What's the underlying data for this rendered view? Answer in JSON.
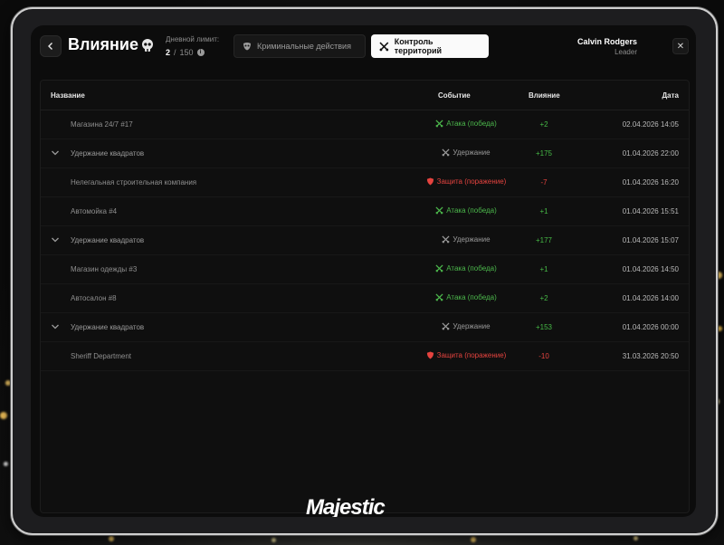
{
  "header": {
    "title": "Влияние",
    "limit_label": "Дневной лимит:",
    "limit_current": "2",
    "limit_separator": "/",
    "limit_max": "150",
    "tabs": [
      {
        "label": "Криминальные действия",
        "icon": "mask-icon",
        "active": false
      },
      {
        "label": "Контроль территорий",
        "icon": "crossed-swords-icon",
        "active": true
      }
    ],
    "user_name": "Calvin Rodgers",
    "user_role": "Leader"
  },
  "table": {
    "columns": {
      "name": "Название",
      "event": "Событие",
      "influence": "Влияние",
      "date": "Дата"
    },
    "rows": [
      {
        "name": "Магазина 24/7 #17",
        "group": false,
        "event": "Атака (победа)",
        "event_type": "attack",
        "influence": "+2",
        "date": "02.04.2026 14:05"
      },
      {
        "name": "Удержание квадратов",
        "group": true,
        "event": "Удержание",
        "event_type": "hold",
        "influence": "+175",
        "date": "01.04.2026 22:00"
      },
      {
        "name": "Нелегальная строительная компания",
        "group": false,
        "event": "Защита (поражение)",
        "event_type": "defense",
        "influence": "-7",
        "date": "01.04.2026 16:20"
      },
      {
        "name": "Автомойка #4",
        "group": false,
        "event": "Атака (победа)",
        "event_type": "attack",
        "influence": "+1",
        "date": "01.04.2026 15:51"
      },
      {
        "name": "Удержание квадратов",
        "group": true,
        "event": "Удержание",
        "event_type": "hold",
        "influence": "+177",
        "date": "01.04.2026 15:07"
      },
      {
        "name": "Магазин одежды #3",
        "group": false,
        "event": "Атака (победа)",
        "event_type": "attack",
        "influence": "+1",
        "date": "01.04.2026 14:50"
      },
      {
        "name": "Автосалон #8",
        "group": false,
        "event": "Атака (победа)",
        "event_type": "attack",
        "influence": "+2",
        "date": "01.04.2026 14:00"
      },
      {
        "name": "Удержание квадратов",
        "group": true,
        "event": "Удержание",
        "event_type": "hold",
        "influence": "+153",
        "date": "01.04.2026 00:00"
      },
      {
        "name": "Sheriff Department",
        "group": false,
        "event": "Защита (поражение)",
        "event_type": "defense",
        "influence": "-10",
        "date": "31.03.2026 20:50"
      }
    ]
  },
  "brand": {
    "logo_text": "Majestic"
  },
  "colors": {
    "accent_positive": "#46b946",
    "accent_negative": "#e5433f",
    "logo_accent": "#e03c3c"
  }
}
